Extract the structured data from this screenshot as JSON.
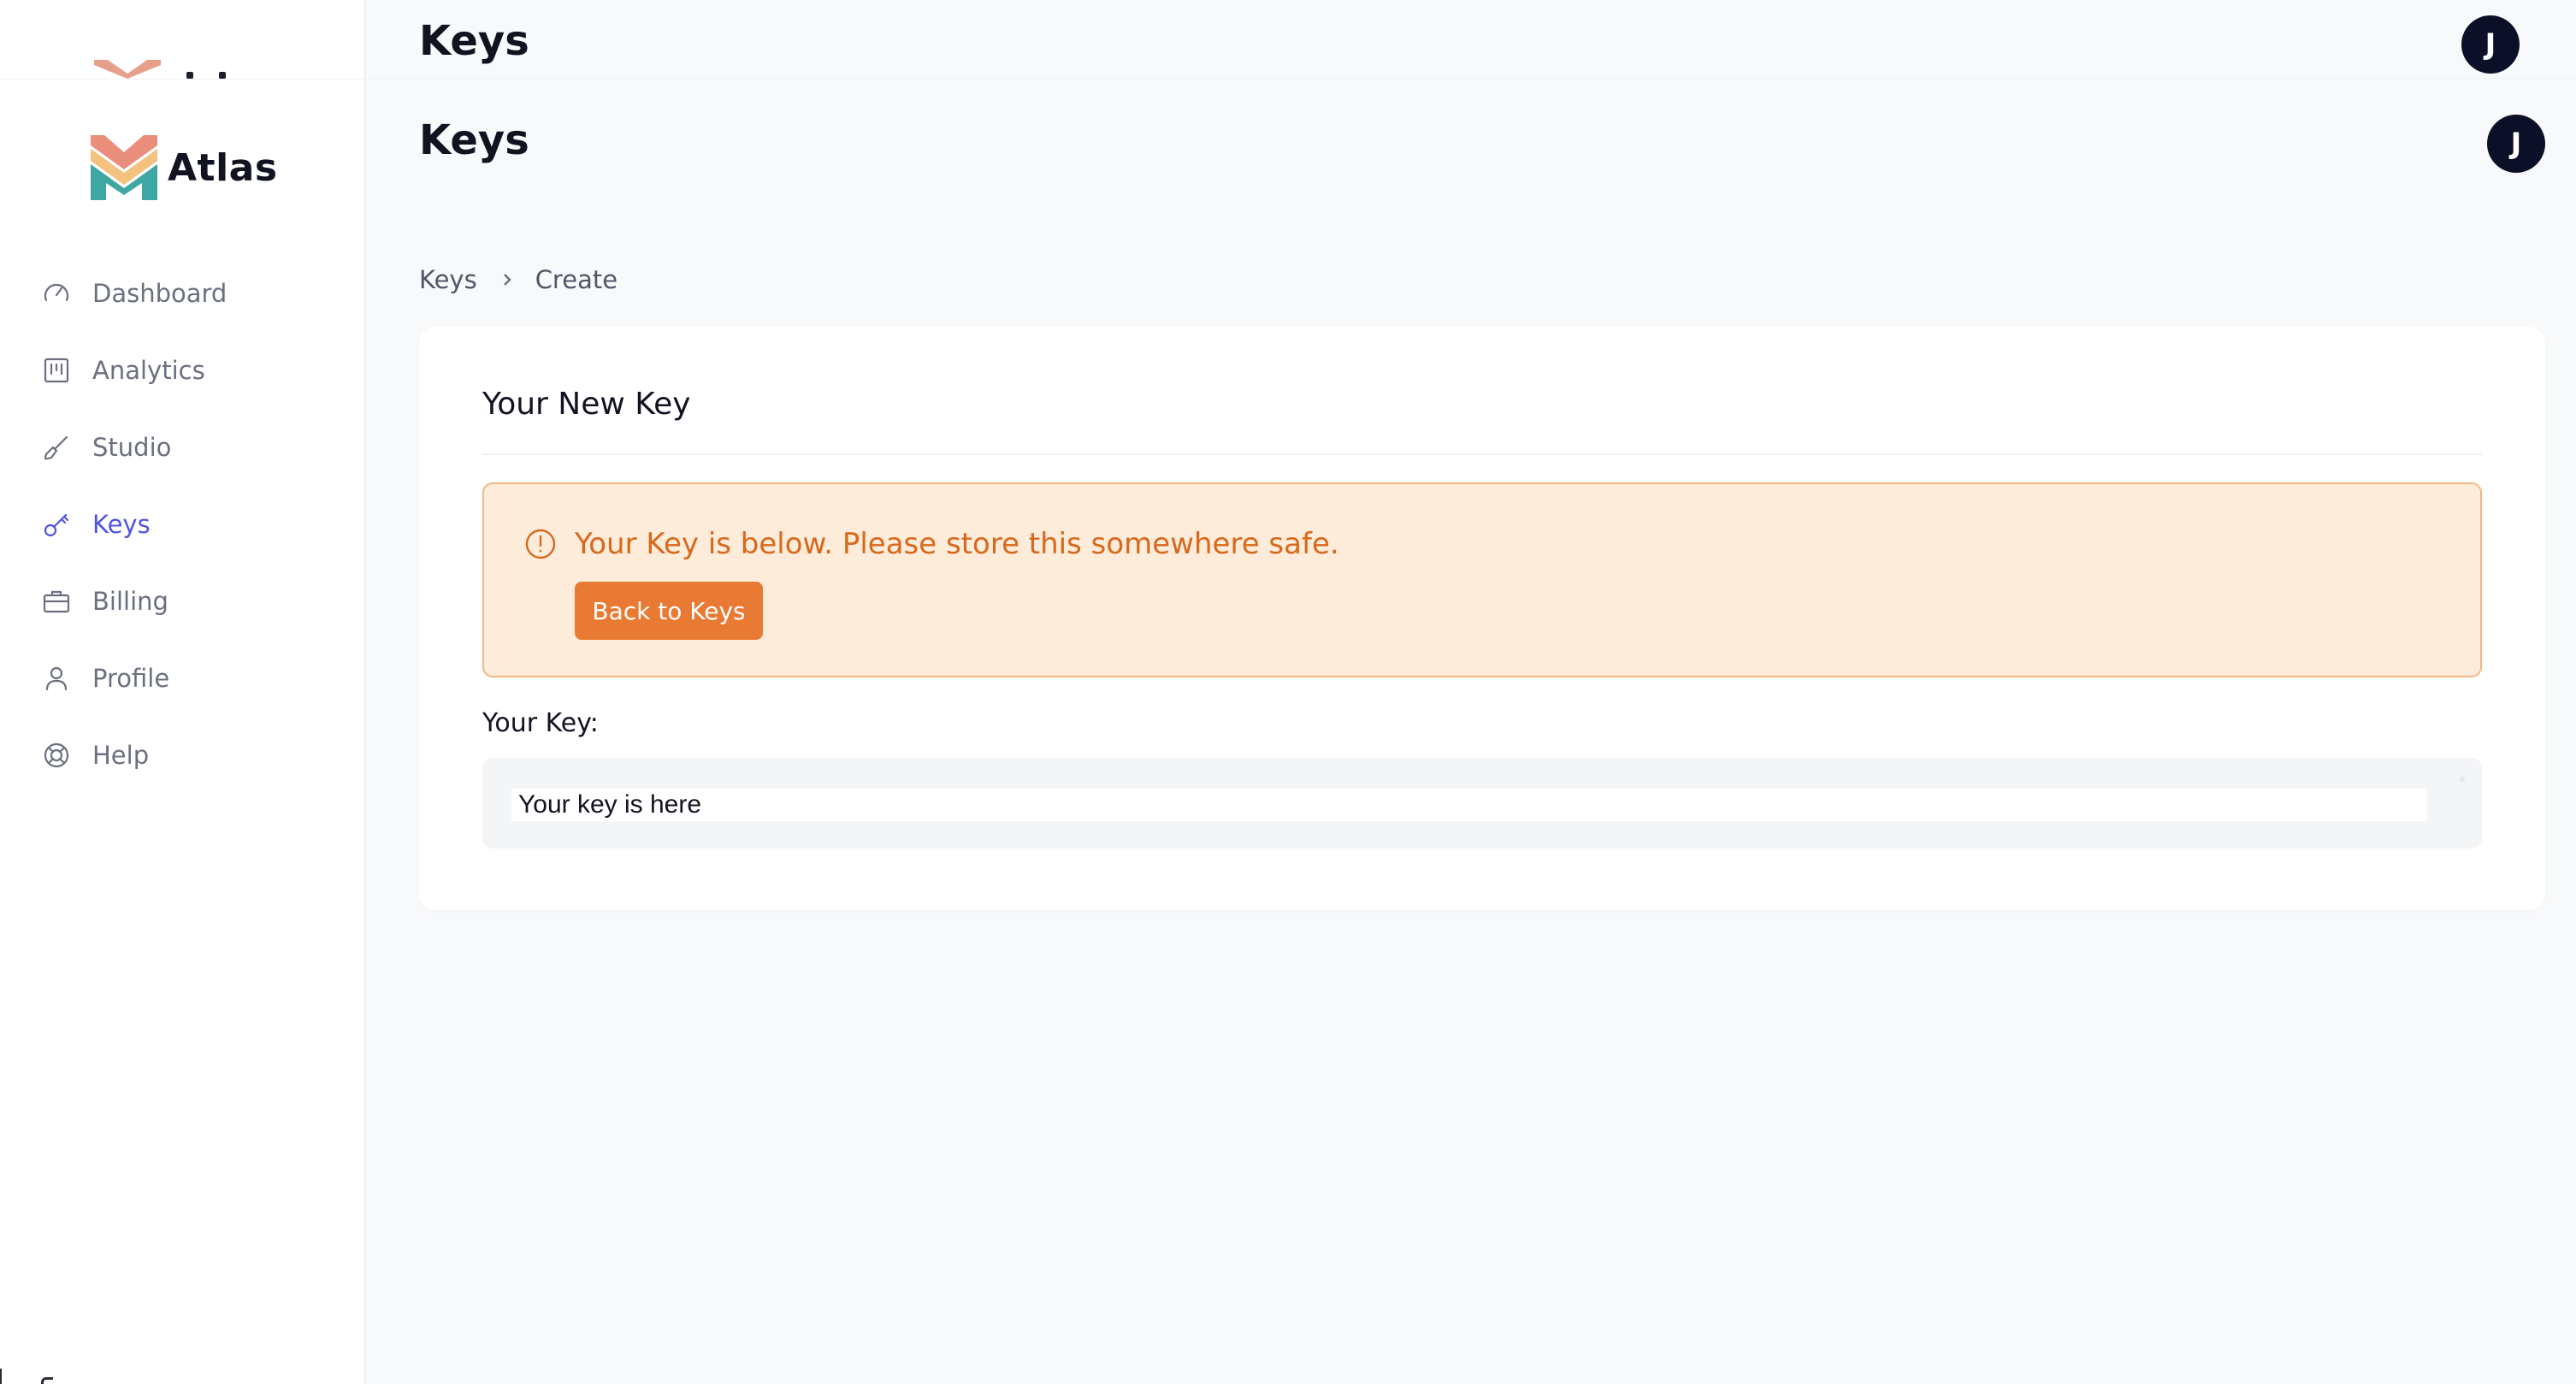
{
  "app": {
    "name": "Atlas"
  },
  "header": {
    "title": "Keys",
    "avatar_initial": "J"
  },
  "sidebar": {
    "items": [
      {
        "label": "Dashboard",
        "icon": "gauge-icon",
        "active": false
      },
      {
        "label": "Analytics",
        "icon": "chart-columns-icon",
        "active": false
      },
      {
        "label": "Studio",
        "icon": "brush-icon",
        "active": false
      },
      {
        "label": "Keys",
        "icon": "key-icon",
        "active": true
      },
      {
        "label": "Billing",
        "icon": "briefcase-icon",
        "active": false
      },
      {
        "label": "Profile",
        "icon": "user-icon",
        "active": false
      },
      {
        "label": "Help",
        "icon": "lifebuoy-icon",
        "active": false
      }
    ]
  },
  "breadcrumb": {
    "items": [
      "Keys",
      "Create"
    ]
  },
  "card": {
    "title": "Your New Key",
    "alert": {
      "message": "Your Key is below. Please store this somewhere safe.",
      "button_label": "Back to Keys",
      "icon": "exclamation-circle-icon"
    },
    "key_label": "Your Key:",
    "key_value": "Your key is here"
  },
  "colors": {
    "accent": "#4f55e3",
    "warning_text": "#d8681c",
    "warning_bg": "#fdecd9",
    "warning_border": "#f1b97f",
    "button_bg": "#e87a33",
    "avatar_bg": "#0b1028"
  }
}
